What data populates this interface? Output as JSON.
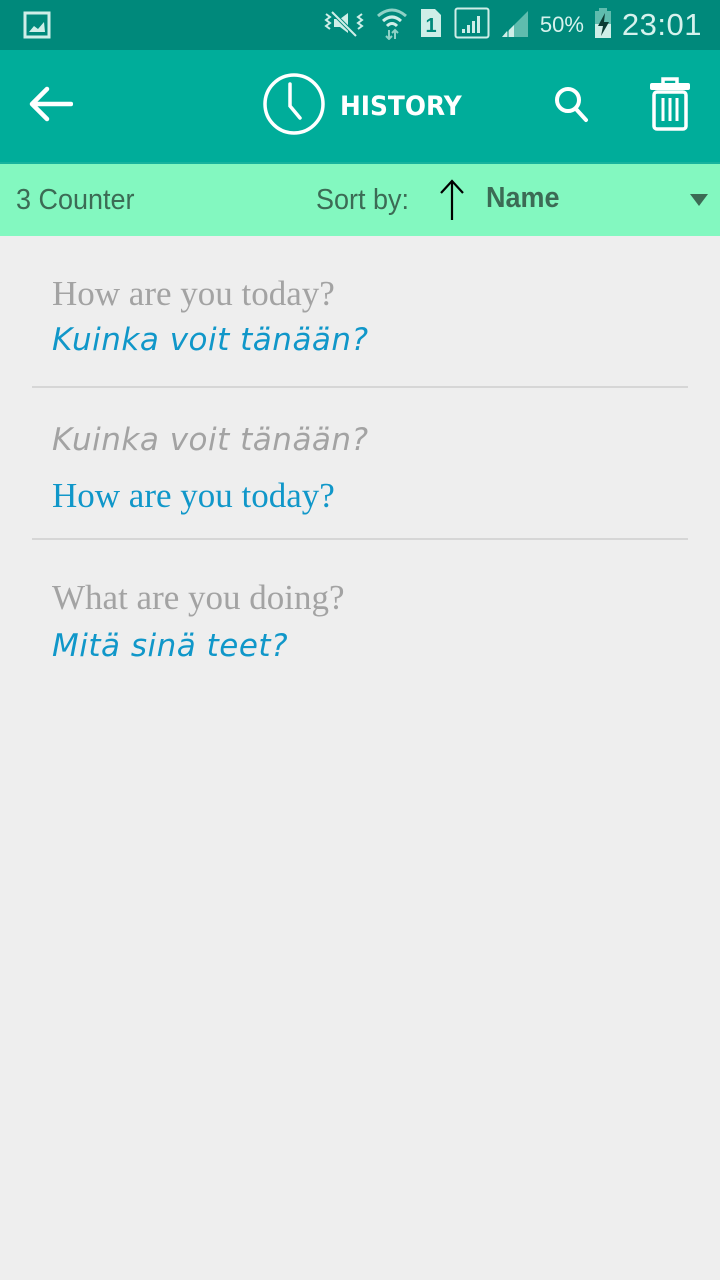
{
  "status_bar": {
    "time": "23:01",
    "battery_percent": "50%",
    "sim_slot": "1",
    "icons": [
      "gallery-notification-icon",
      "mute-vibrate-icon",
      "wifi-icon",
      "sim-1-icon",
      "signal-icon",
      "signal-icon-2",
      "battery-charging-icon"
    ]
  },
  "app_bar": {
    "title": "HISTORY",
    "back_icon": "arrow-left-icon",
    "title_icon": "clock-icon",
    "search_icon": "search-icon",
    "delete_icon": "trash-icon"
  },
  "sort_bar": {
    "counter": "3 Counter",
    "sort_label": "Sort by:",
    "sort_direction": "ascending",
    "sort_value": "Name"
  },
  "history": [
    {
      "source": "How are you today?",
      "translation": "Kuinka voit tänään?"
    },
    {
      "source": "Kuinka voit tänään?",
      "translation": "How are you today?"
    },
    {
      "source": "What are you doing?",
      "translation": "Mitä sinä teet?"
    }
  ],
  "colors": {
    "status_bar": "#00897b",
    "app_bar": "#00ad9a",
    "sort_bar": "#83f8c0",
    "source_text": "#a3a3a3",
    "translation_text": "#1097c9",
    "background": "#eeeeee"
  }
}
